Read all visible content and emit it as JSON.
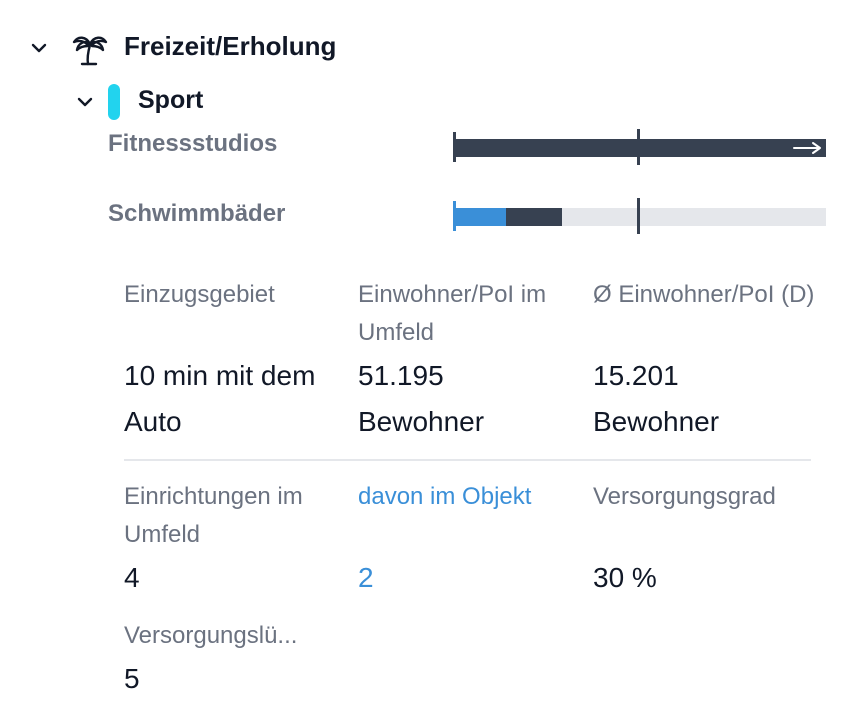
{
  "group": {
    "title": "Freizeit/Erholung",
    "icon": "palm-tree-icon",
    "expanded": true
  },
  "subgroup": {
    "title": "Sport",
    "color": "#22d3ee",
    "expanded": true
  },
  "rows": [
    {
      "label": "Fitnessstudios",
      "bar_fill": 1.0,
      "bar_overflow": true,
      "dark_color": "#374151",
      "overflow_icon": "arrow-right-icon"
    },
    {
      "label": "Schwimmbäder",
      "bar_blue_fraction": 0.14,
      "bar_dark_fraction": 0.29,
      "blue_color": "#3a8fd8",
      "dark_color": "#374151",
      "track_color": "#e5e7eb"
    }
  ],
  "details": {
    "einzugsgebiet_label": "Einzugsgebiet",
    "einzugsgebiet_value": "10 min mit dem Auto",
    "einwohner_label": "Einwohner/PoI im Umfeld",
    "einwohner_value": "51.195 Bewohner",
    "avg_label": "Ø Einwohner/PoI (D)",
    "avg_value": "15.201 Bewohner",
    "einrichtungen_label": "Einrichtungen im Umfeld",
    "einrichtungen_value": "4",
    "davon_label": "davon im Objekt",
    "davon_value": "2",
    "versorgungsgrad_label": "Versorgungsgrad",
    "versorgungsgrad_value": "30 %",
    "luecke_label": "Versorgungslü...",
    "luecke_value": "5"
  }
}
